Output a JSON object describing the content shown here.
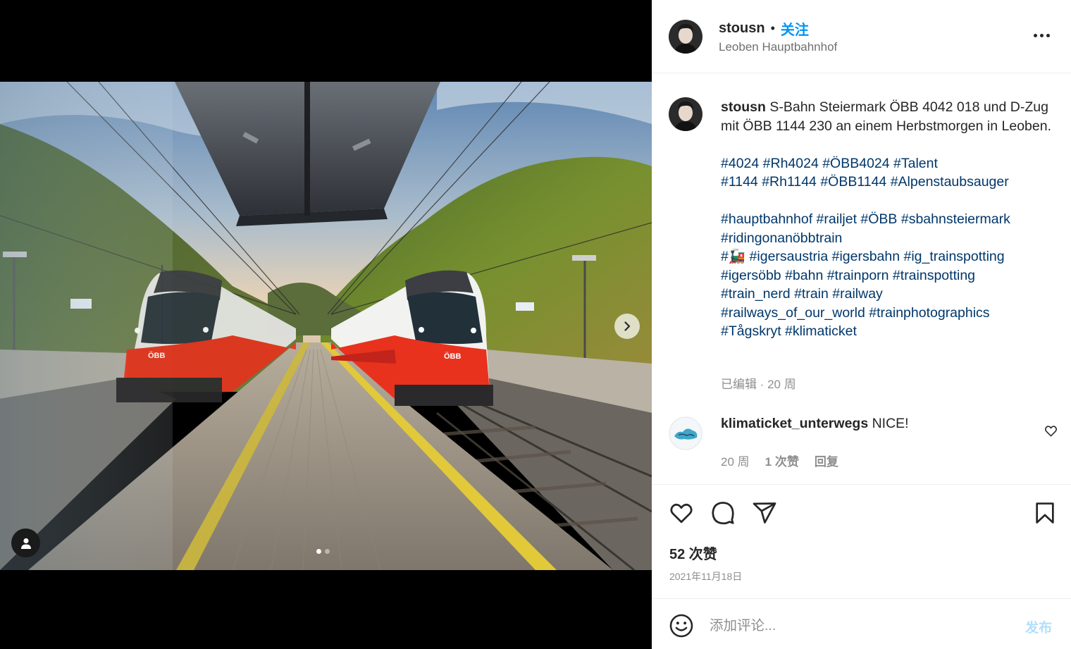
{
  "post": {
    "author": "stousn",
    "separator": "•",
    "follow_label": "关注",
    "location": "Leoben Hauptbahnhof",
    "more_icon": "more-horizontal-icon"
  },
  "caption": {
    "author": "stousn",
    "text": "S-Bahn Steiermark ÖBB 4042 018 und D-Zug mit ÖBB 1144 230 an einem Herbstmorgen in Leoben.",
    "hashtag_lines": [
      "#4024 #Rh4024 #ÖBB4024 #Talent",
      "#1144 #Rh1144 #ÖBB1144 #Alpenstaubsauger",
      "",
      "#hauptbahnhof #railjet #ÖBB #sbahnsteiermark",
      "#ridingonanöbbtrain",
      "#🚂 #igersaustria #igersbahn #ig_trainspotting",
      "#igersöbb #bahn #trainporn #trainspotting",
      "#train_nerd #train #railway",
      "#railways_of_our_world #trainphotographics",
      "#Tågskryt #klimaticket"
    ],
    "meta": "已编辑 · 20 周"
  },
  "comment": {
    "author": "klimaticket_unterwegs",
    "text": "NICE!",
    "age": "20 周",
    "likes": "1 次赞",
    "reply": "回复"
  },
  "actions": {
    "likes": "52 次赞",
    "date": "2021年11月18日",
    "icons": [
      "heart-icon",
      "comment-icon",
      "share-icon",
      "bookmark-icon"
    ]
  },
  "comment_box": {
    "placeholder": "添加评论...",
    "post_label": "发布"
  },
  "carousel": {
    "current": 1,
    "total": 2
  },
  "colors": {
    "accent": "#0095f6",
    "hashtag": "#00376b",
    "muted": "#8e8e8e",
    "train_red": "#e8321e"
  }
}
